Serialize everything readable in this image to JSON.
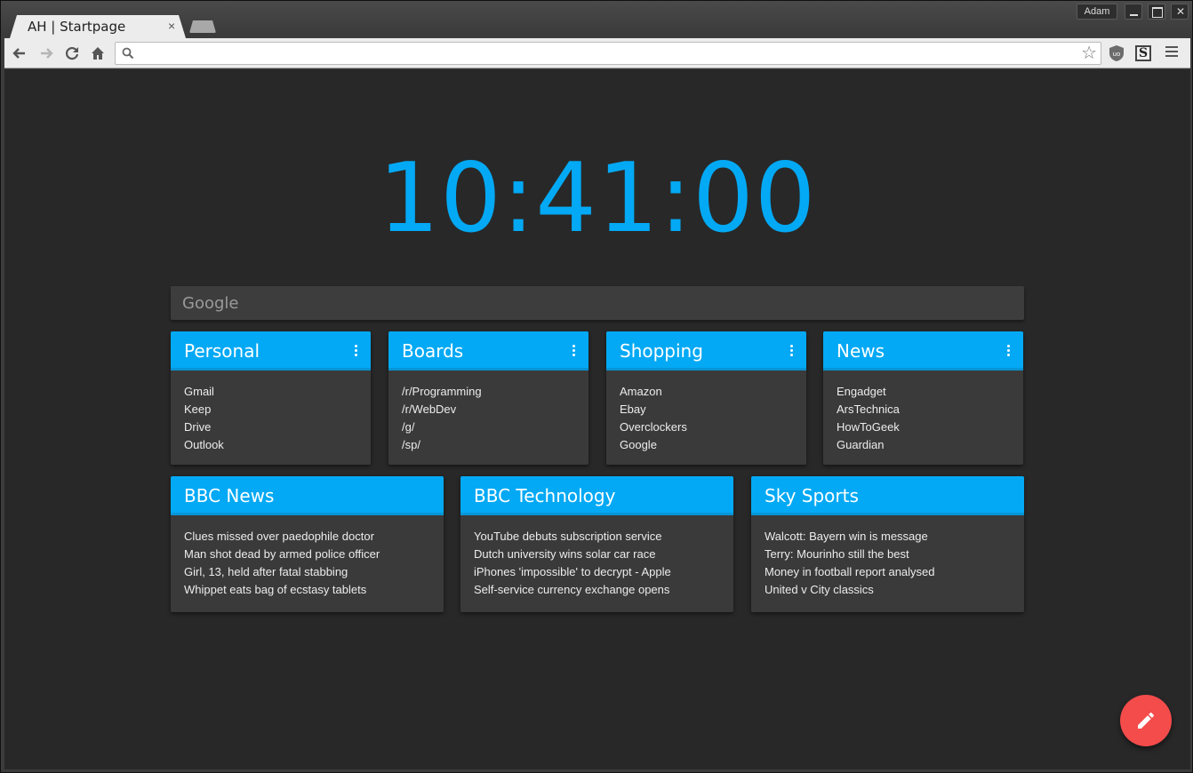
{
  "browser": {
    "tab_title": "AH | Startpage",
    "tab_close": "×",
    "profile_name": "Adam",
    "close_glyph": "✕",
    "address_value": "",
    "icons": [
      "back-arrow-icon",
      "forward-arrow-icon",
      "reload-icon",
      "home-icon",
      "search-icon",
      "star-icon",
      "ublock-icon",
      "s-extension-icon",
      "menu-icon"
    ],
    "extension_s_label": "S"
  },
  "page": {
    "clock": "10:41:00",
    "search_placeholder": "Google",
    "accent_color": "#03a9f4",
    "background_color": "#282828",
    "fab_color": "#f44b4b",
    "fab_icon": "pencil-icon"
  },
  "link_cards": [
    {
      "title": "Personal",
      "links": [
        "Gmail",
        "Keep",
        "Drive",
        "Outlook"
      ]
    },
    {
      "title": "Boards",
      "links": [
        "/r/Programming",
        "/r/WebDev",
        "/g/",
        "/sp/"
      ]
    },
    {
      "title": "Shopping",
      "links": [
        "Amazon",
        "Ebay",
        "Overclockers",
        "Google"
      ]
    },
    {
      "title": "News",
      "links": [
        "Engadget",
        "ArsTechnica",
        "HowToGeek",
        "Guardian"
      ]
    }
  ],
  "feed_cards": [
    {
      "title": "BBC News",
      "items": [
        "Clues missed over paedophile doctor",
        "Man shot dead by armed police officer",
        "Girl, 13, held after fatal stabbing",
        "Whippet eats bag of ecstasy tablets"
      ]
    },
    {
      "title": "BBC Technology",
      "items": [
        "YouTube debuts subscription service",
        "Dutch university wins solar car race",
        "iPhones 'impossible' to decrypt - Apple",
        "Self-service currency exchange opens"
      ]
    },
    {
      "title": "Sky Sports",
      "items": [
        "Walcott: Bayern win is message",
        "Terry: Mourinho still the best",
        "Money in football report analysed",
        "United v City classics"
      ]
    }
  ]
}
